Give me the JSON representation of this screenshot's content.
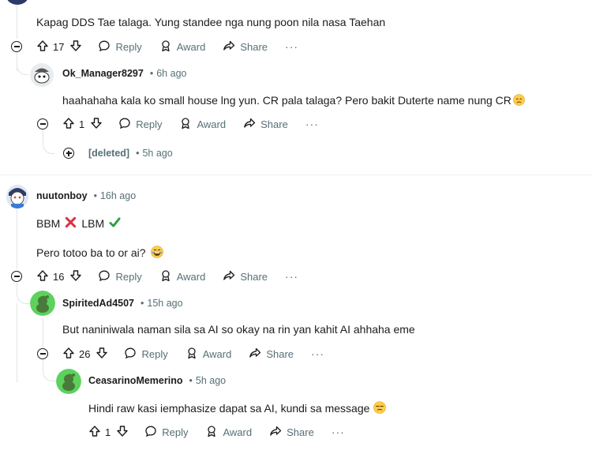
{
  "actions": {
    "reply": "Reply",
    "award": "Award",
    "share": "Share",
    "more": "···"
  },
  "comments": [
    {
      "body": "Kapag DDS Tae talaga. Yung standee nga nung poon nila nasa Taehan",
      "votes": "17"
    },
    {
      "author": "Ok_Manager8297",
      "time": "6h ago",
      "body": "haahahaha kala ko small house lng yun. CR pala talaga? Pero bakit Duterte name nung CR",
      "votes": "1"
    },
    {
      "author": "[deleted]",
      "time": "5h ago"
    },
    {
      "author": "nuutonboy",
      "time": "16h ago",
      "body_line1": "BBM",
      "body_line1b": "LBM",
      "body_line2": "Pero totoo ba to or ai?",
      "votes": "16"
    },
    {
      "author": "SpiritedAd4507",
      "time": "15h ago",
      "body": "But naniniwala naman sila sa AI so okay na rin yan kahit AI ahhaha eme",
      "votes": "26"
    },
    {
      "author": "CeasarinoMemerino",
      "time": "5h ago",
      "body": "Hindi raw kasi iemphasize dapat sa AI, kundi sa message",
      "votes": "1"
    }
  ],
  "separator_dot": "•"
}
